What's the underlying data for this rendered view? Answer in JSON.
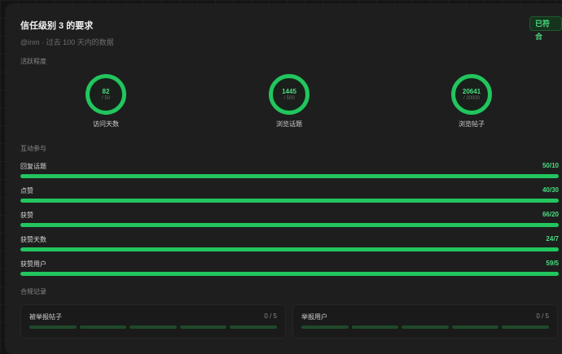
{
  "header": {
    "title": "信任级别 3 的要求",
    "badge": "已符合",
    "subtitle": "@inm · 过去 100 天内的数据"
  },
  "activity": {
    "section_label": "活跃程度",
    "rings": [
      {
        "value": "82",
        "max": "/ 50",
        "label": "访问天数"
      },
      {
        "value": "1445",
        "max": "/ 500",
        "label": "浏览话题"
      },
      {
        "value": "20641",
        "max": "/ 20000",
        "label": "浏览帖子"
      }
    ]
  },
  "engagement": {
    "section_label": "互动参与",
    "metrics": [
      {
        "label": "回复话题",
        "value": "50/10",
        "progress": 1.0
      },
      {
        "label": "点赞",
        "value": "40/30",
        "progress": 1.0
      },
      {
        "label": "获赞",
        "value": "66/20",
        "progress": 1.0
      },
      {
        "label": "获赞天数",
        "value": "24/7",
        "progress": 1.0
      },
      {
        "label": "获赞用户",
        "value": "59/5",
        "progress": 1.0
      }
    ]
  },
  "compliance": {
    "section_label": "合规记录",
    "items": [
      {
        "label": "被举报帖子",
        "count": "0 / 5"
      },
      {
        "label": "举报用户",
        "count": "0 / 5"
      }
    ]
  },
  "colors": {
    "accent": "#22c55e",
    "accent_text": "#4ade80",
    "card_bg": "#1e1e1e"
  }
}
